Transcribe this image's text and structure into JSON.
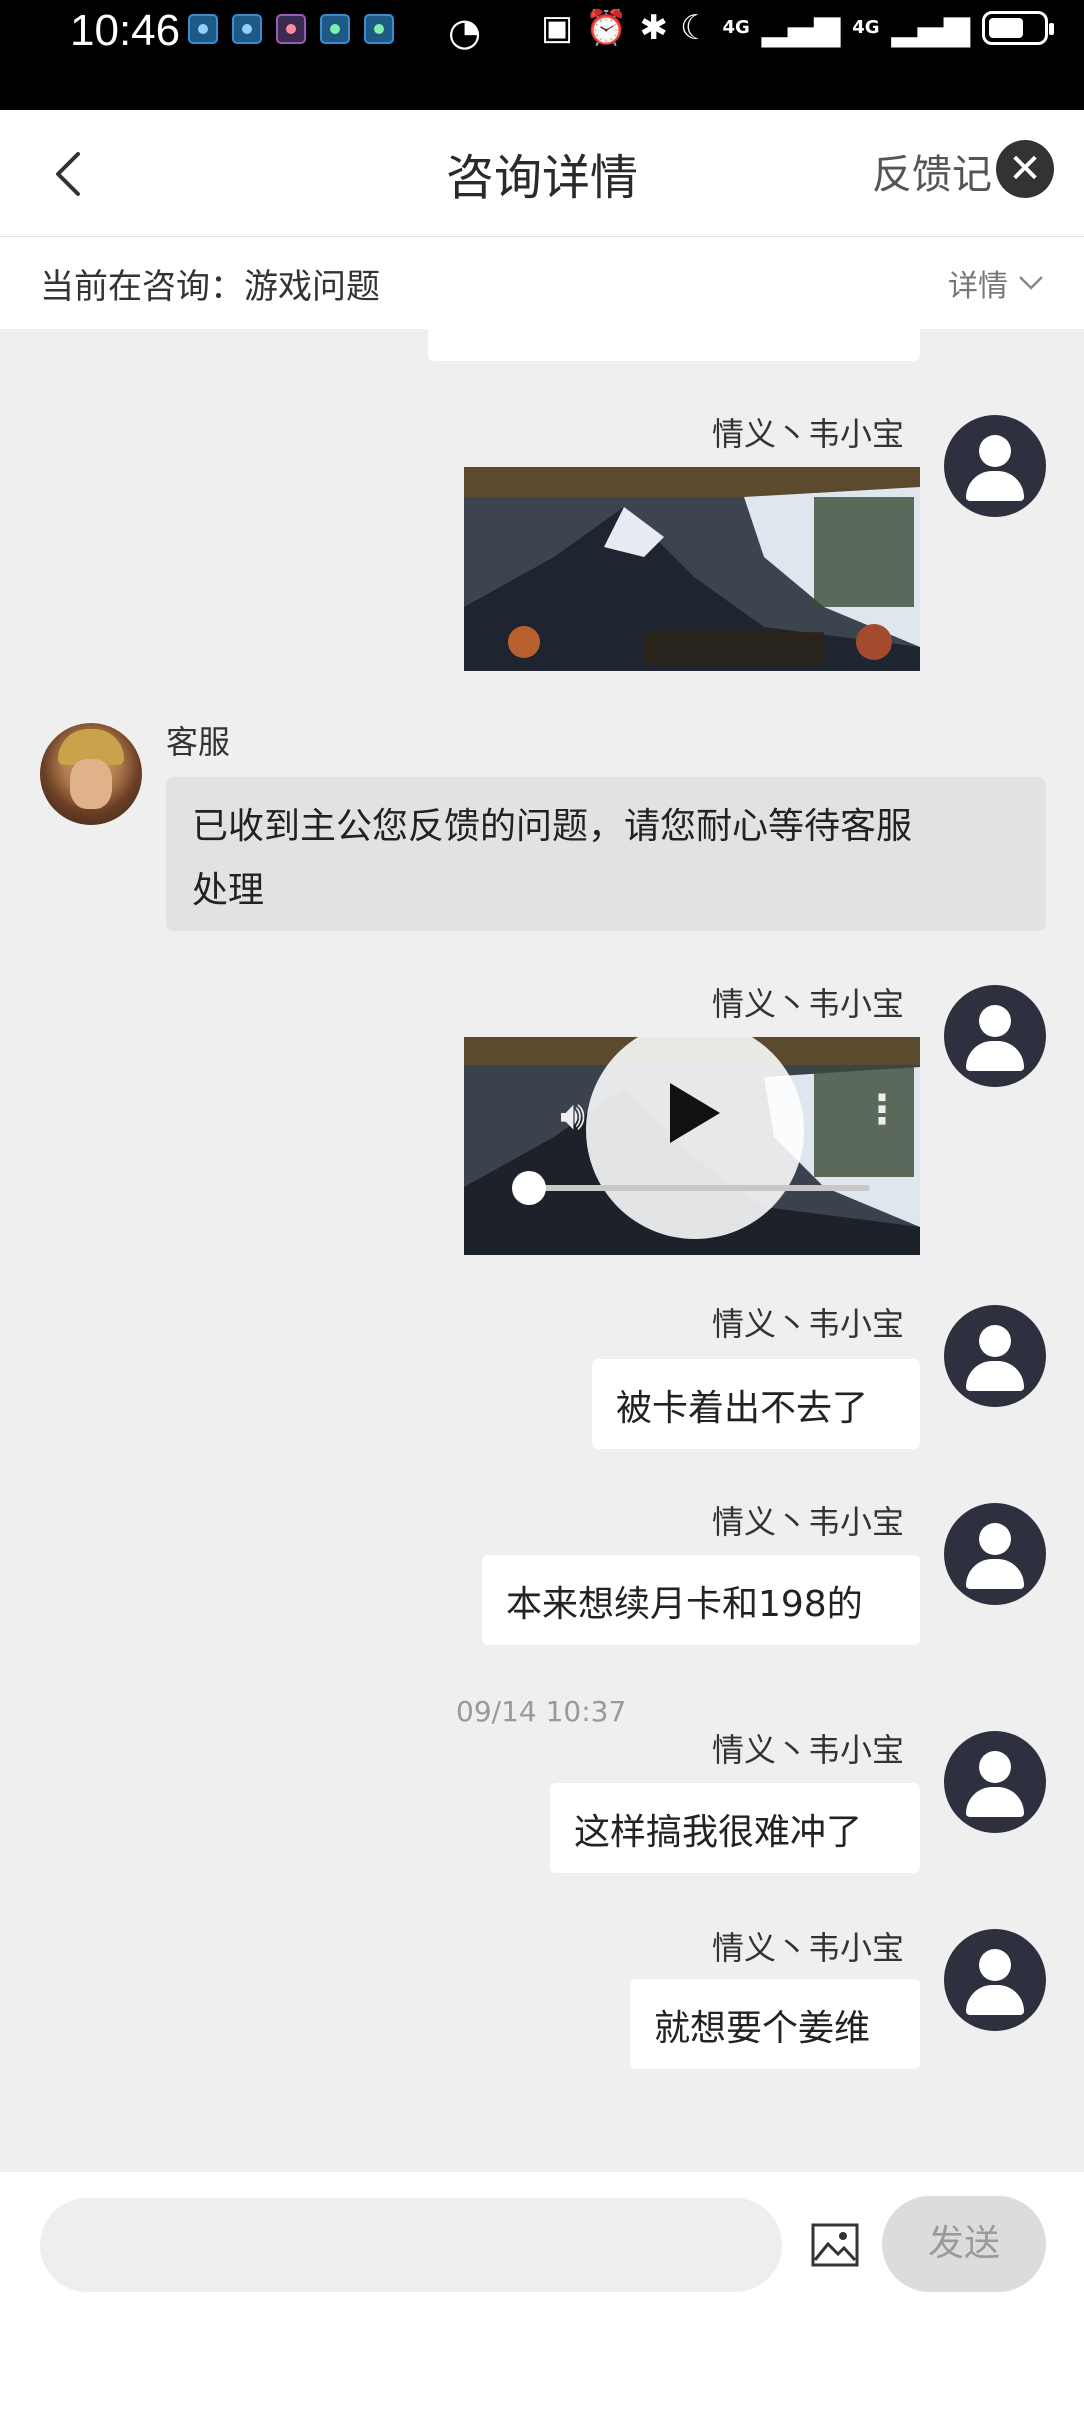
{
  "status_bar": {
    "time": "10:46",
    "network1": "4G",
    "network2": "4G"
  },
  "header": {
    "title": "咨询详情",
    "feedback_link": "反馈记",
    "close_icon": "✕"
  },
  "topic": {
    "label": "当前在咨询：",
    "value": "游戏问题",
    "detail_label": "详情"
  },
  "messages": [
    {
      "type": "image",
      "sender": "情义丶韦小宝",
      "side": "right"
    },
    {
      "type": "text",
      "sender": "客服",
      "side": "left",
      "text_line1": "已收到主公您反馈的问题，请您耐心等待客服",
      "text_line2": "处理"
    },
    {
      "type": "video",
      "sender": "情义丶韦小宝",
      "side": "right"
    },
    {
      "type": "text",
      "sender": "情义丶韦小宝",
      "side": "right",
      "text": "被卡着出不去了"
    },
    {
      "type": "text",
      "sender": "情义丶韦小宝",
      "side": "right",
      "text": "本来想续月卡和198的"
    },
    {
      "type": "timestamp",
      "text": "09/14 10:37"
    },
    {
      "type": "text",
      "sender": "情义丶韦小宝",
      "side": "right",
      "text": "这样搞我很难冲了"
    },
    {
      "type": "text",
      "sender": "情义丶韦小宝",
      "side": "right",
      "text": "就想要个姜维"
    }
  ],
  "input": {
    "placeholder": "",
    "send_label": "发送"
  },
  "colors": {
    "user_avatar": "#2e3040",
    "chat_bg": "#efefef",
    "bubble_user": "#ffffff",
    "bubble_cs": "#e2e2e2"
  }
}
